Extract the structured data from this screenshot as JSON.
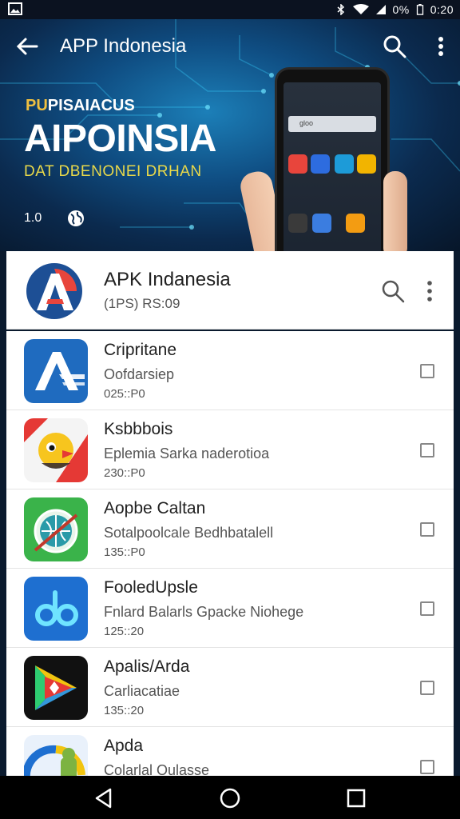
{
  "status_bar": {
    "battery_text": "0%",
    "time": "0:20",
    "icons": [
      "image-icon",
      "bluetooth-icon",
      "wifi-icon",
      "signal-icon",
      "battery-icon"
    ]
  },
  "app_bar": {
    "title": "APP Indonesia",
    "icons": [
      "back-arrow-icon",
      "search-icon",
      "more-vert-icon"
    ]
  },
  "hero": {
    "kicker_yellow": "PU",
    "kicker_white": "PISAIACUS",
    "heading": "AIPOINSIA",
    "subheading": "DAT DBENONEI DRHAN",
    "version": "1.0",
    "accent_color": "#e9d94a",
    "phone_search_text": "gloo",
    "phone_app_colors": [
      "#e8453c",
      "#2d6cdf",
      "#1d9bd8",
      "#f2b400",
      "#3a3a3a",
      "#3b7de0",
      "#f39c12"
    ]
  },
  "header": {
    "title": "APK Indanesia",
    "subtitle": "(1PS) RS:09",
    "icons": [
      "app-logo-icon",
      "search-icon",
      "more-vert-icon"
    ]
  },
  "apps": [
    {
      "name": "Cripritane",
      "desc": "Oofdarsiep",
      "size": "025::P0",
      "icon": "a-logo-icon",
      "bg": "#1f6bbf"
    },
    {
      "name": "Ksbbbois",
      "desc": "Eplemia Sarka naderotioa",
      "size": "230::P0",
      "icon": "bird-icon",
      "bg": "#f4f4f4"
    },
    {
      "name": "Aopbe Caltan",
      "desc": "Sotalpoolcale  Bedhbatalell",
      "size": "135::P0",
      "icon": "globe-icon",
      "bg": "#3ab34a"
    },
    {
      "name": "FooledUpsle",
      "desc": "Fnlard Balarls Gpacke Niohege",
      "size": "125::20",
      "icon": "do-logo-icon",
      "bg": "#1e6fd0"
    },
    {
      "name": "Apalis/Arda",
      "desc": "Carliacatiae",
      "size": "135::20",
      "icon": "play-arrow-icon",
      "bg": "#111111"
    },
    {
      "name": "Apda",
      "desc": "Colarlal Oulasse",
      "size": "",
      "icon": "android-icon",
      "bg": "#e9f1fb"
    }
  ],
  "navbar": {
    "icons": [
      "back-triangle-icon",
      "home-circle-icon",
      "recents-square-icon"
    ]
  }
}
